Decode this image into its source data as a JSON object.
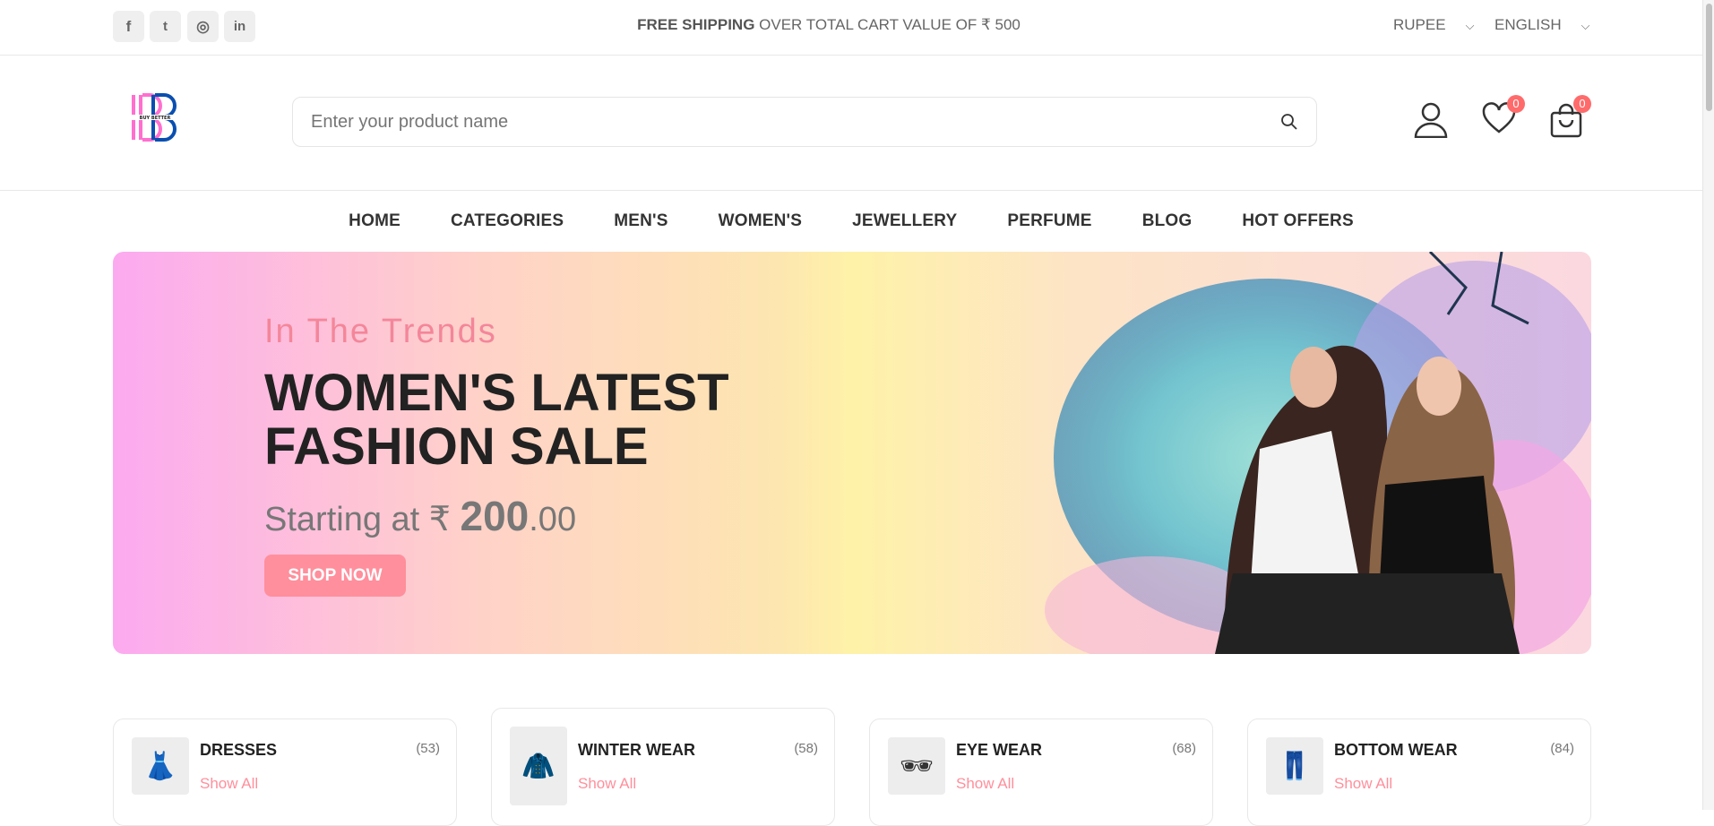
{
  "topbar": {
    "social": [
      {
        "name": "facebook-icon",
        "glyph": "f"
      },
      {
        "name": "twitter-icon",
        "glyph": "t"
      },
      {
        "name": "instagram-icon",
        "glyph": "◎"
      },
      {
        "name": "linkedin-icon",
        "glyph": "in"
      }
    ],
    "shipping_bold": "FREE SHIPPING",
    "shipping_rest": " OVER TOTAL CART VALUE OF ₹ 500",
    "currency": "RUPEE",
    "language": "ENGLISH"
  },
  "header": {
    "logo_text": "BUY BETTER",
    "search_placeholder": "Enter your product name",
    "wishlist_count": "0",
    "cart_count": "0"
  },
  "nav": [
    "HOME",
    "CATEGORIES",
    "MEN'S",
    "WOMEN'S",
    "JEWELLERY",
    "PERFUME",
    "BLOG",
    "HOT OFFERS"
  ],
  "banner": {
    "subtitle": "In The Trends",
    "title_line1": "WOMEN'S LATEST",
    "title_line2": "FASHION SALE",
    "price_prefix": "Starting at ₹ ",
    "price_main": "200",
    "price_decimal": ".00",
    "button": "SHOP NOW"
  },
  "categories": [
    {
      "name": "DRESSES",
      "count": "(53)",
      "link": "Show All",
      "icon": "👗"
    },
    {
      "name": "WINTER WEAR",
      "count": "(58)",
      "link": "Show All",
      "icon": "🧥"
    },
    {
      "name": "EYE WEAR",
      "count": "(68)",
      "link": "Show All",
      "icon": "🕶"
    },
    {
      "name": "BOTTOM WEAR",
      "count": "(84)",
      "link": "Show All",
      "icon": "👖"
    }
  ],
  "colors": {
    "accent": "#ff8f9c",
    "badge": "#ff6b6b",
    "logo_pink": "#ff6fcf",
    "logo_blue": "#0a4fb0"
  }
}
